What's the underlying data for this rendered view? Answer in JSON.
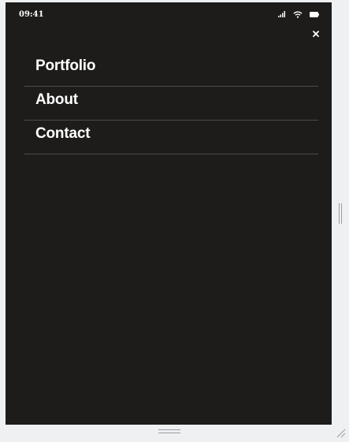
{
  "status_bar": {
    "time": "09:41",
    "icons": [
      "signal-icon",
      "wifi-icon",
      "battery-icon"
    ]
  },
  "close_button": {
    "label": "×",
    "icon": "close-icon"
  },
  "menu": {
    "items": [
      {
        "label": "Portfolio"
      },
      {
        "label": "About"
      },
      {
        "label": "Contact"
      }
    ]
  },
  "colors": {
    "background": "#1d1c1a",
    "text": "#ffffff",
    "divider": "#4e4c49",
    "frame": "#eef0f2"
  }
}
